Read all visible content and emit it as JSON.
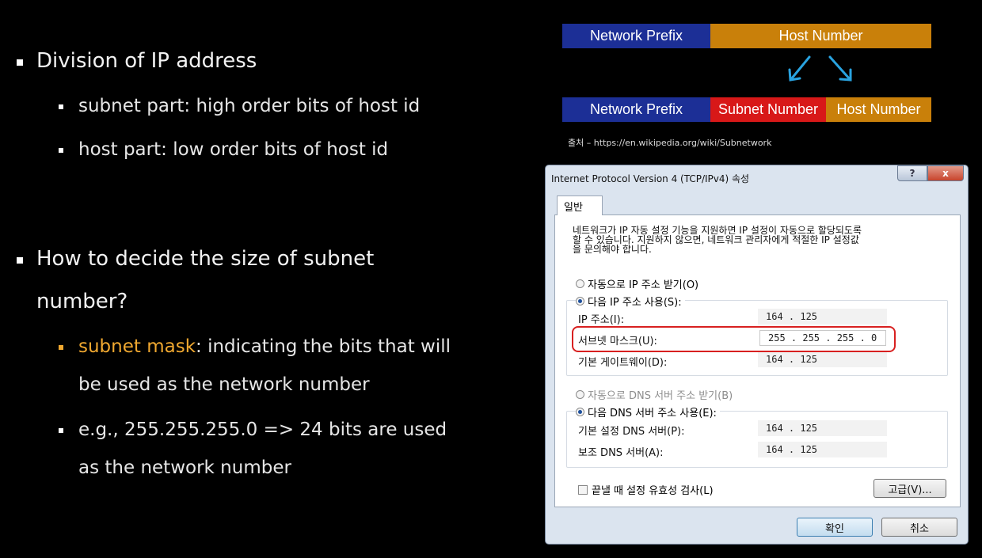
{
  "slide": {
    "b1": "Division of IP address",
    "b1a": "subnet part: high order bits of host id",
    "b1b": "host part: low order bits of host id",
    "b2_line1": "How to decide the size of subnet",
    "b2_line2": "number?",
    "b2a_highlight": "subnet mask",
    "b2a_rest": ": indicating the bits that will",
    "b2a_line2": "be used as the network number",
    "b2b_line1": "e.g., 255.255.255.0 => 24 bits are used",
    "b2b_line2": "as the network number",
    "accent_color": "#f0a830"
  },
  "diagram": {
    "top_network": "Network Prefix",
    "top_host": "Host Number",
    "bot_network": "Network Prefix",
    "bot_subnet": "Subnet Number",
    "bot_host": "Host Number",
    "source": "출처 – https://en.wikipedia.org/wiki/Subnetwork",
    "colors": {
      "network": "#1c2f96",
      "host": "#c9800a",
      "subnet": "#d81818",
      "arrow": "#29a3e0"
    }
  },
  "dialog": {
    "title": "Internet Protocol Version 4 (TCP/IPv4) 속성",
    "help": "?",
    "close": "x",
    "tab": "일반",
    "desc_l1": "네트워크가 IP 자동 설정 기능을 지원하면 IP 설정이 자동으로 할당되도록",
    "desc_l2": "할 수 있습니다. 지원하지 않으면, 네트워크 관리자에게 적절한 IP 설정값",
    "desc_l3": "을 문의해야 합니다.",
    "radio_auto_ip": "자동으로 IP 주소 받기(O)",
    "radio_manual_ip": "다음 IP 주소 사용(S):",
    "ip_label": "IP 주소(I):",
    "ip_value": "164 . 125",
    "mask_label": "서브넷 마스크(U):",
    "mask_value": "255 . 255 . 255 .  0",
    "gw_label": "기본 게이트웨이(D):",
    "gw_value": "164 . 125",
    "radio_auto_dns": "자동으로 DNS 서버 주소 받기(B)",
    "radio_manual_dns": "다음 DNS 서버 주소 사용(E):",
    "dns1_label": "기본 설정 DNS 서버(P):",
    "dns1_value": "164 . 125",
    "dns2_label": "보조 DNS 서버(A):",
    "dns2_value": "164 . 125",
    "validate_label": "끝낼 때 설정 유효성 검사(L)",
    "advanced": "고급(V)...",
    "ok": "확인",
    "cancel": "취소"
  }
}
